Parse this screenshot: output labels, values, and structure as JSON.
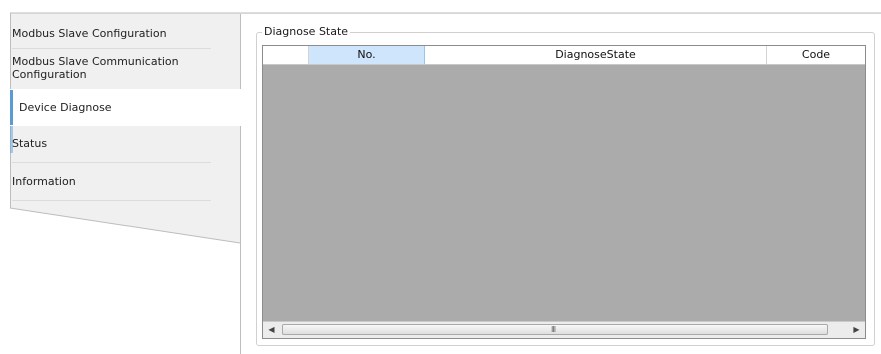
{
  "sidebar": {
    "items": [
      {
        "label": "Modbus Slave Configuration"
      },
      {
        "label": "Modbus Slave Communication"
      },
      {
        "label": "Configuration"
      },
      {
        "label": "Device Diagnose"
      },
      {
        "label": "Status"
      },
      {
        "label": "Information"
      }
    ],
    "selected_index": 3,
    "accent_color": "#5b9bd5"
  },
  "main": {
    "group_title": "Diagnose State",
    "grid": {
      "columns": [
        "No.",
        "DiagnoseState",
        "Code"
      ],
      "rows": [],
      "selected_column": "No.",
      "scrollbar": {
        "left_icon": "scroll-left-arrow-icon",
        "right_icon": "scroll-right-arrow-icon",
        "grip": "III"
      }
    }
  }
}
